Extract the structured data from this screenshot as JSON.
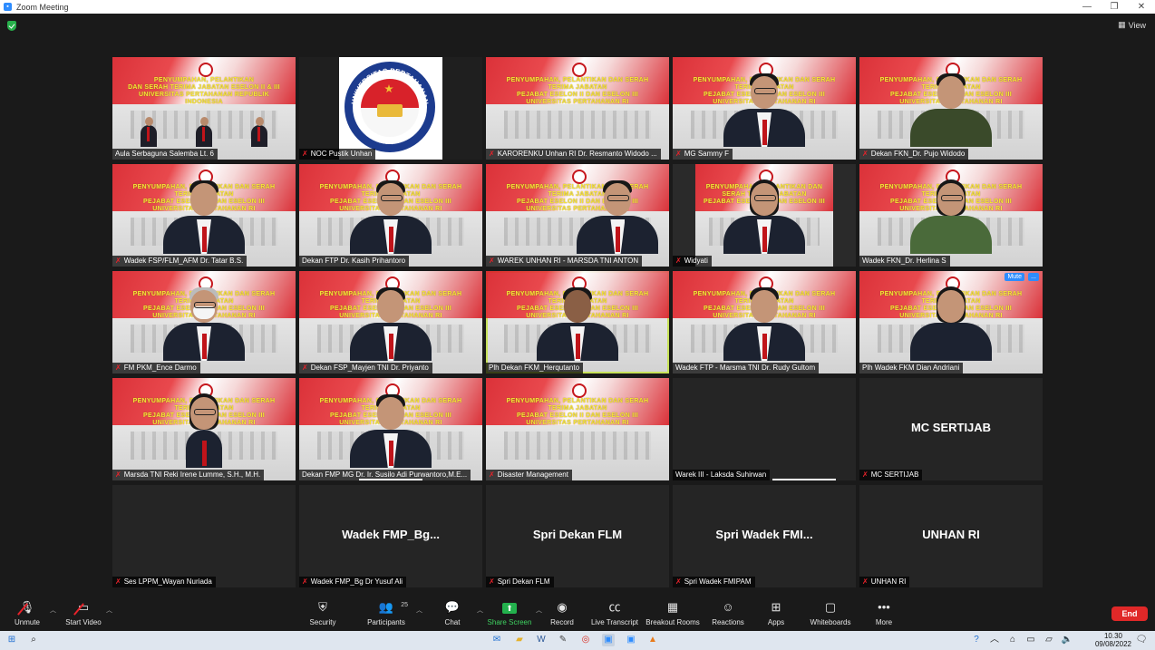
{
  "window": {
    "title": "Zoom Meeting"
  },
  "top_bar": {
    "view_label": "View"
  },
  "banner": {
    "line1": "PENYUMPAHAN, PELANTIKAN DAN SERAH TERIMA JABATAN",
    "line2": "PEJABAT ESELON II DAN ESELON III",
    "line3": "UNIVERSITAS PERTAHANAN RI",
    "tile1_line1": "PENYUMPAHAN, PELANTIKAN",
    "tile1_line2": "DAN SERAH TERIMA JABATAN ESELON II & III",
    "tile1_line3": "UNIVERSITAS PERTAHANAN REPUBLIK INDONESIA"
  },
  "participants": [
    {
      "name": "Aula Serbaguna Salemba Lt. 6"
    },
    {
      "name": "NOC Pustik Unhan"
    },
    {
      "name": "KARORENKU Unhan RI Dr. Resmanto Widodo ..."
    },
    {
      "name": "MG Sammy F"
    },
    {
      "name": "Dekan FKN_Dr. Pujo Widodo"
    },
    {
      "name": "Wadek FSP/FLM_AFM Dr. Tatar B.S."
    },
    {
      "name": "Dekan FTP Dr. Kasih Prihantoro"
    },
    {
      "name": "WAREK UNHAN RI - MARSDA TNI ANTON"
    },
    {
      "name": "Widyati"
    },
    {
      "name": "Wadek FKN_Dr. Herlina S"
    },
    {
      "name": "FM PKM_Ence Darmo"
    },
    {
      "name": "Dekan FSP_Mayjen TNI Dr. Priyanto"
    },
    {
      "name": "Plh Dekan FKM_Herqutanto"
    },
    {
      "name": "Wadek FTP - Marsma TNI Dr. Rudy Gultom"
    },
    {
      "name": "Plh Wadek FKM Dian Andriani"
    },
    {
      "name": "Marsda TNI Reki Irene Lumme, S.H., M.H."
    },
    {
      "name": "Dekan FMP MG Dr. Ir. Susilo Adi Purwantoro,M.E..."
    },
    {
      "name": "Disaster Management"
    },
    {
      "name": "Warek III - Laksda Suhirwan"
    },
    {
      "name": "MC SERTIJAB",
      "display": "MC SERTIJAB"
    },
    {
      "name": "Ses LPPM_Wayan Nuriada"
    },
    {
      "name": "Wadek FMP_Bg Dr Yusuf Ali",
      "display": "Wadek  FMP_Bg..."
    },
    {
      "name": "Spri Dekan FLM",
      "display": "Spri Dekan FLM"
    },
    {
      "name": "Spri Wadek FMIPAM",
      "display": "Spri  Wadek FMI..."
    },
    {
      "name": "UNHAN RI",
      "display": "UNHAN RI"
    }
  ],
  "tile_actions": {
    "mute": "Mute",
    "more": "..."
  },
  "logo": {
    "top": "UNIVERSITAS PERTAHANAN",
    "bottom": "REPUBLIK INDONESIA"
  },
  "toolbar": {
    "unmute": "Unmute",
    "start_video": "Start Video",
    "security": "Security",
    "participants": "Participants",
    "participants_count": "25",
    "chat": "Chat",
    "share_screen": "Share Screen",
    "record": "Record",
    "live_transcript": "Live Transcript",
    "breakout_rooms": "Breakout Rooms",
    "reactions": "Reactions",
    "apps": "Apps",
    "whiteboards": "Whiteboards",
    "more": "More",
    "end": "End"
  },
  "taskbar": {
    "time": "10.30",
    "date": "09/08/2022"
  }
}
